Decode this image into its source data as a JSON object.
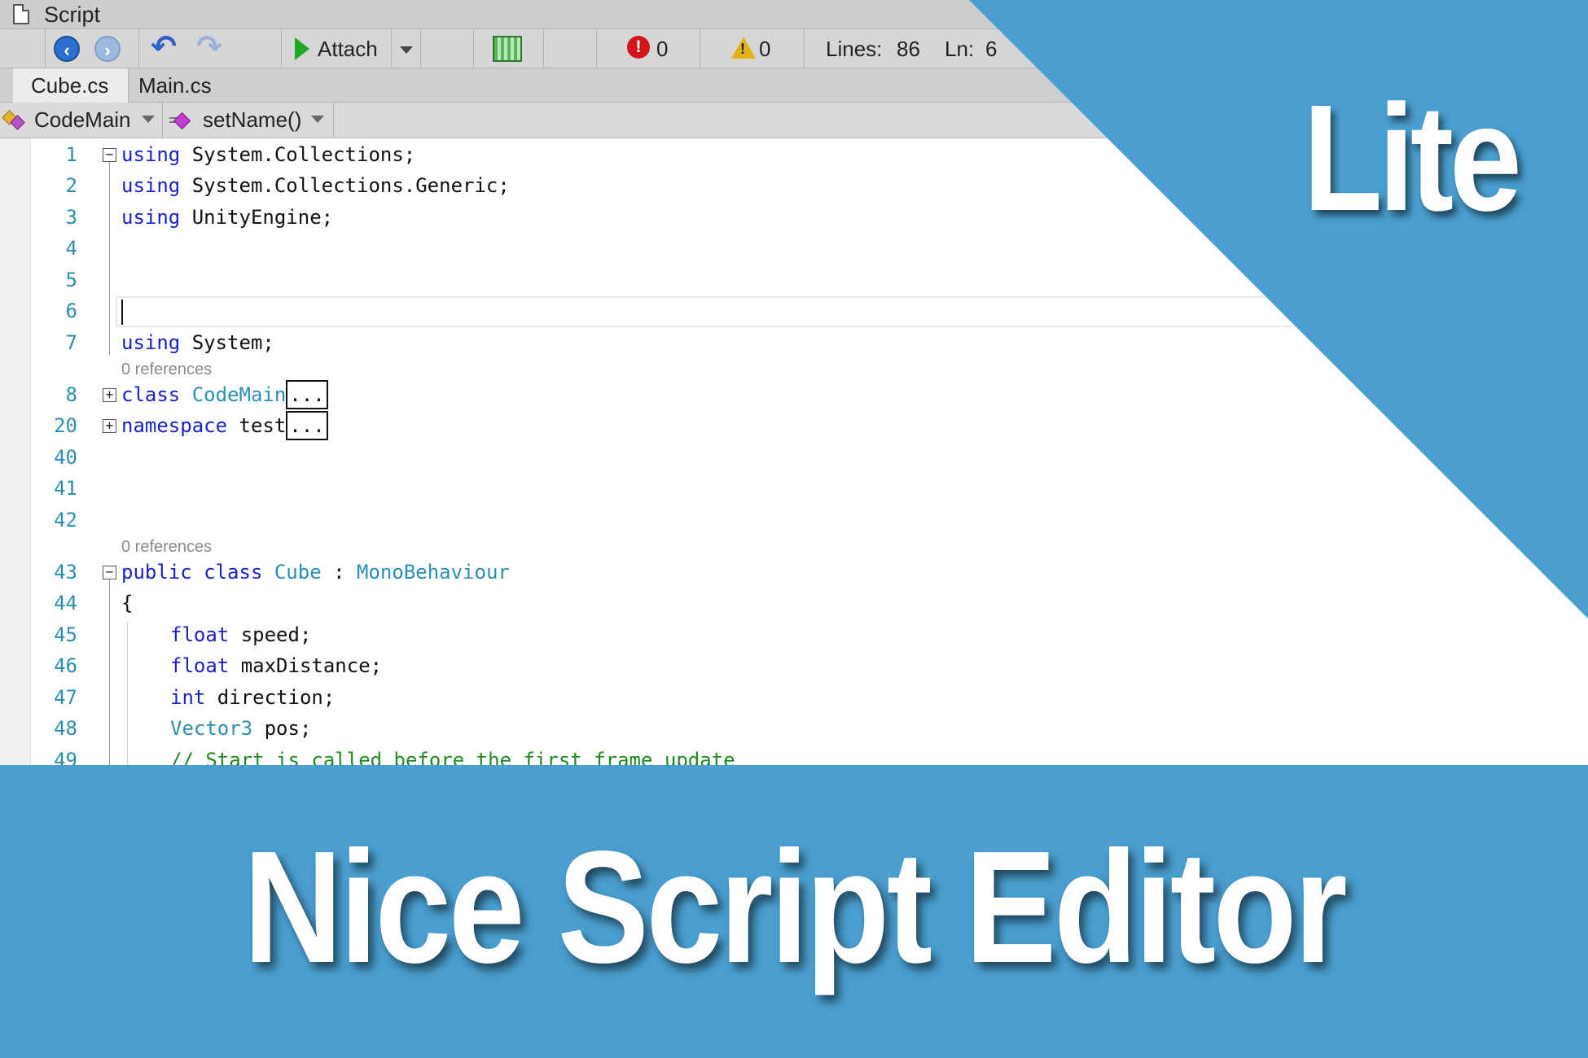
{
  "window": {
    "title": "Script"
  },
  "toolbar": {
    "attach_label": "Attach",
    "errors": "0",
    "warnings": "0",
    "lines_label": "Lines:",
    "lines_value": "86",
    "ln_label": "Ln:",
    "ln_value": "6"
  },
  "tabs": [
    {
      "label": "Cube.cs",
      "active": true
    },
    {
      "label": "Main.cs",
      "active": false
    }
  ],
  "navbar": {
    "class_label": "CodeMain",
    "method_label": "setName()"
  },
  "code": {
    "refs": "0 references",
    "collapsed": "...",
    "lines": [
      {
        "n": "1",
        "kw": "using",
        "rest": " System.Collections;"
      },
      {
        "n": "2",
        "kw": "using",
        "rest": " System.Collections.Generic;"
      },
      {
        "n": "3",
        "kw": "using",
        "rest": " UnityEngine;"
      },
      {
        "n": "4"
      },
      {
        "n": "5"
      },
      {
        "n": "6"
      },
      {
        "n": "7",
        "kw": "using",
        "rest": " System;"
      },
      {
        "n": "8",
        "kw": "class",
        "ty": "CodeMain"
      },
      {
        "n": "20",
        "kw": "namespace",
        "rest": " test"
      },
      {
        "n": "40"
      },
      {
        "n": "41"
      },
      {
        "n": "42"
      },
      {
        "n": "43",
        "kw1": "public",
        "kw2": "class",
        "ty1": "Cube",
        "colon": " : ",
        "ty2": "MonoBehaviour"
      },
      {
        "n": "44",
        "text": "{"
      },
      {
        "n": "45",
        "kw": "float",
        "rest": " speed;"
      },
      {
        "n": "46",
        "kw": "float",
        "rest": " maxDistance;"
      },
      {
        "n": "47",
        "kw": "int",
        "rest": " direction;"
      },
      {
        "n": "48",
        "ty": "Vector3",
        "rest": " pos;"
      },
      {
        "n": "49",
        "comment": "// Start is called before the first frame update"
      }
    ]
  },
  "overlay": {
    "badge": "Lite",
    "banner_title": "Nice Script Editor"
  },
  "colors": {
    "accent": "#4a9fd0",
    "keyword": "#1a21c9",
    "type": "#2b8fb5",
    "comment": "#1f8a1f",
    "error": "#d0161c",
    "warning": "#e6b116",
    "run": "#23a623"
  },
  "icons": [
    "document-icon",
    "back-arrow-icon",
    "forward-arrow-icon",
    "undo-icon",
    "redo-icon",
    "play-icon",
    "dropdown-icon",
    "build-icon",
    "error-icon",
    "warning-icon",
    "class-icon",
    "method-icon",
    "fold-minus-icon",
    "fold-plus-icon"
  ]
}
